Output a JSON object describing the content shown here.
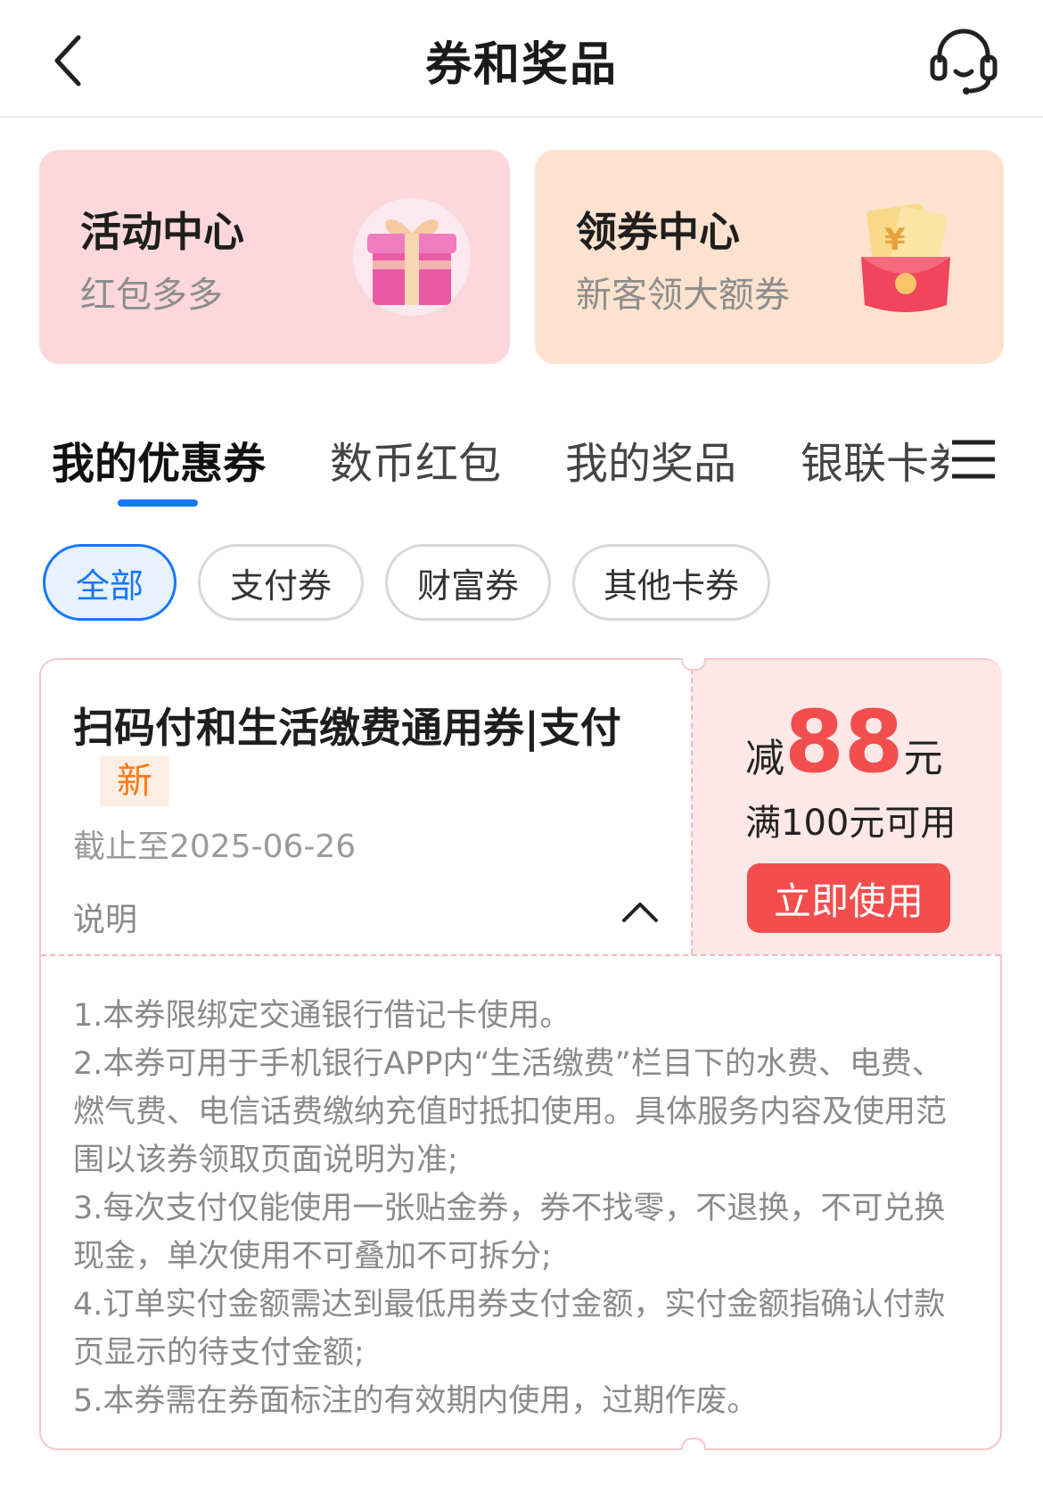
{
  "header": {
    "title": "券和奖品"
  },
  "promos": [
    {
      "title": "活动中心",
      "subtitle": "红包多多",
      "icon": "gift-box-icon"
    },
    {
      "title": "领券中心",
      "subtitle": "新客领大额券",
      "icon": "red-envelope-coupon-icon"
    }
  ],
  "tabs": [
    {
      "label": "我的优惠券",
      "active": true
    },
    {
      "label": "数币红包",
      "active": false
    },
    {
      "label": "我的奖品",
      "active": false
    },
    {
      "label": "银联卡券",
      "active": false
    }
  ],
  "filters": [
    {
      "label": "全部",
      "active": true
    },
    {
      "label": "支付券",
      "active": false
    },
    {
      "label": "财富券",
      "active": false
    },
    {
      "label": "其他卡券",
      "active": false
    }
  ],
  "coupon": {
    "name": "扫码付和生活缴费通用券|支付",
    "badge": "新",
    "expiry": "截止至2025-06-26",
    "description_label": "说明",
    "discount_prefix": "减",
    "discount_amount": "88",
    "discount_unit": "元",
    "threshold": "满100元可用",
    "use_button": "立即使用",
    "rules": [
      "1.本券限绑定交通银行借记卡使用。",
      "2.本券可用于手机银行APP内“生活缴费”栏目下的水费、电费、燃气费、电信话费缴纳充值时抵扣使用。具体服务内容及使用范围以该券领取页面说明为准;",
      "3.每次支付仅能使用一张贴金券，券不找零，不退换，不可兑换现金，单次使用不可叠加不可拆分;",
      "4.订单实付金额需达到最低用券支付金额，实付金额指确认付款页显示的待支付金额;",
      "5.本券需在券面标注的有效期内使用，过期作废。"
    ]
  },
  "colors": {
    "accent_blue": "#1677ff",
    "coupon_red": "#f24e4e",
    "activity_bg": "#fcd8dc",
    "coupon_center_bg": "#fde3cf"
  }
}
